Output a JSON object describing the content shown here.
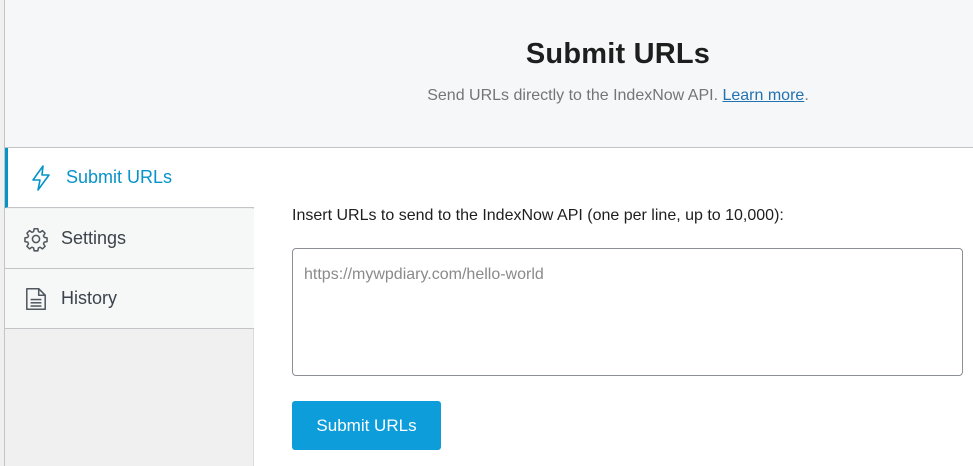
{
  "header": {
    "title": "Submit URLs",
    "subtitle": "Send URLs directly to the IndexNow API.",
    "learn_more_label": "Learn more",
    "trailing_period": "."
  },
  "sidebar": {
    "items": [
      {
        "label": "Submit URLs",
        "icon": "lightning-bolt-icon",
        "active": true
      },
      {
        "label": "Settings",
        "icon": "gear-icon",
        "active": false
      },
      {
        "label": "History",
        "icon": "document-icon",
        "active": false
      }
    ]
  },
  "form": {
    "label": "Insert URLs to send to the IndexNow API (one per line, up to 10,000):",
    "textarea_value": "",
    "textarea_placeholder": "https://mywpdiary.com/hello-world",
    "submit_label": "Submit URLs"
  },
  "colors": {
    "accent": "#0693c9",
    "button": "#0d9ddb",
    "link": "#2271b1"
  }
}
